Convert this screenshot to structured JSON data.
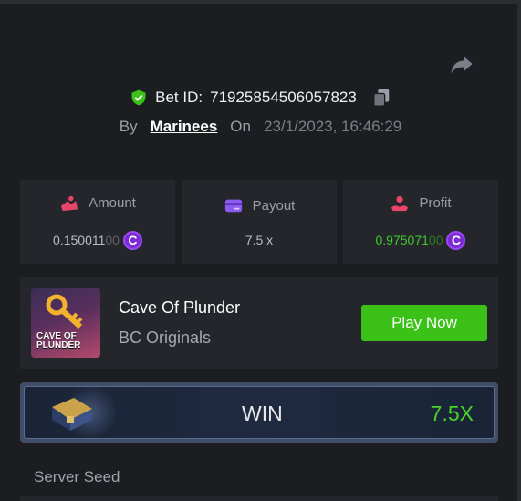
{
  "bet": {
    "id_label": "Bet ID:",
    "id": "71925854506057823",
    "by_label": "By",
    "user": "Marinees",
    "on_label": "On",
    "datetime": "23/1/2023, 16:46:29"
  },
  "stats": {
    "amount": {
      "label": "Amount",
      "value": "0.150011",
      "value_dim": "00",
      "icon": "amount-icon",
      "color": "#e8456b"
    },
    "payout": {
      "label": "Payout",
      "value": "7.5 x",
      "icon": "card-icon",
      "color": "#8c5cf0"
    },
    "profit": {
      "label": "Profit",
      "value": "0.975071",
      "value_dim": "00",
      "icon": "profit-icon",
      "color": "#e8456b"
    },
    "coin_symbol": "C"
  },
  "game": {
    "title": "Cave Of Plunder",
    "provider": "BC Originals",
    "thumb_title_line1": "CAVE OF",
    "thumb_title_line2": "PLUNDER",
    "play_label": "Play Now"
  },
  "result": {
    "label": "WIN",
    "multiplier": "7.5X"
  },
  "seed": {
    "label": "Server Seed"
  },
  "colors": {
    "background": "#1c1d20",
    "card": "#24262b",
    "accent_green": "#3bc117",
    "coin_purple": "#7b2bd6"
  }
}
